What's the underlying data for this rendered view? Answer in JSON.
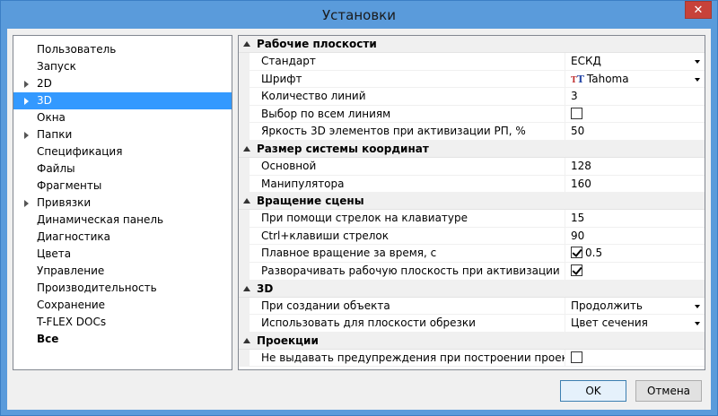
{
  "window": {
    "title": "Установки",
    "close_glyph": "✕"
  },
  "sidebar": {
    "items": [
      {
        "label": "Пользователь",
        "arrow": false,
        "selected": false,
        "bold": false
      },
      {
        "label": "Запуск",
        "arrow": false,
        "selected": false,
        "bold": false
      },
      {
        "label": "2D",
        "arrow": true,
        "selected": false,
        "bold": false
      },
      {
        "label": "3D",
        "arrow": true,
        "selected": true,
        "bold": false
      },
      {
        "label": "Окна",
        "arrow": false,
        "selected": false,
        "bold": false
      },
      {
        "label": "Папки",
        "arrow": true,
        "selected": false,
        "bold": false
      },
      {
        "label": "Спецификация",
        "arrow": false,
        "selected": false,
        "bold": false
      },
      {
        "label": "Файлы",
        "arrow": false,
        "selected": false,
        "bold": false
      },
      {
        "label": "Фрагменты",
        "arrow": false,
        "selected": false,
        "bold": false
      },
      {
        "label": "Привязки",
        "arrow": true,
        "selected": false,
        "bold": false
      },
      {
        "label": "Динамическая панель",
        "arrow": false,
        "selected": false,
        "bold": false
      },
      {
        "label": "Диагностика",
        "arrow": false,
        "selected": false,
        "bold": false
      },
      {
        "label": "Цвета",
        "arrow": false,
        "selected": false,
        "bold": false
      },
      {
        "label": "Управление",
        "arrow": false,
        "selected": false,
        "bold": false
      },
      {
        "label": "Производительность",
        "arrow": false,
        "selected": false,
        "bold": false
      },
      {
        "label": "Сохранение",
        "arrow": false,
        "selected": false,
        "bold": false
      },
      {
        "label": "T-FLEX DOCs",
        "arrow": false,
        "selected": false,
        "bold": false
      },
      {
        "label": "Все",
        "arrow": false,
        "selected": false,
        "bold": true
      }
    ]
  },
  "properties": {
    "groups": [
      {
        "title": "Рабочие плоскости",
        "rows": [
          {
            "name": "Стандарт",
            "type": "dropdown",
            "value": "ЕСКД"
          },
          {
            "name": "Шрифт",
            "type": "font",
            "value": "Tahoma"
          },
          {
            "name": "Количество линий",
            "type": "text",
            "value": "3"
          },
          {
            "name": "Выбор по всем линиям",
            "type": "checkbox",
            "checked": false,
            "value": ""
          },
          {
            "name": "Яркость 3D элементов при активизации РП, %",
            "type": "text",
            "value": "50"
          }
        ]
      },
      {
        "title": "Размер системы координат",
        "rows": [
          {
            "name": "Основной",
            "type": "text",
            "value": "128"
          },
          {
            "name": "Манипулятора",
            "type": "text",
            "value": "160"
          }
        ]
      },
      {
        "title": "Вращение сцены",
        "rows": [
          {
            "name": "При помощи стрелок на клавиатуре",
            "type": "text",
            "value": "15"
          },
          {
            "name": "Ctrl+клавиши стрелок",
            "type": "text",
            "value": "90"
          },
          {
            "name": "Плавное вращение за время, с",
            "type": "checkbox",
            "checked": true,
            "value": "0.5"
          },
          {
            "name": "Разворачивать рабочую плоскость при активизации",
            "type": "checkbox",
            "checked": true,
            "value": ""
          }
        ]
      },
      {
        "title": "3D",
        "rows": [
          {
            "name": "При создании объекта",
            "type": "dropdown",
            "value": "Продолжить"
          },
          {
            "name": "Использовать для плоскости обрезки",
            "type": "dropdown",
            "value": "Цвет сечения"
          }
        ]
      },
      {
        "title": "Проекции",
        "rows": [
          {
            "name": "Не выдавать предупреждения при построении проекций",
            "type": "checkbox",
            "checked": false,
            "value": ""
          }
        ]
      }
    ]
  },
  "buttons": {
    "ok": "OK",
    "cancel": "Отмена"
  },
  "icons": {
    "font_icon": "font-type-icon",
    "font_icon_text": "T"
  },
  "colors": {
    "selection": "#3399ff",
    "titlebar": "#5a9bdb",
    "close": "#c7423a"
  }
}
